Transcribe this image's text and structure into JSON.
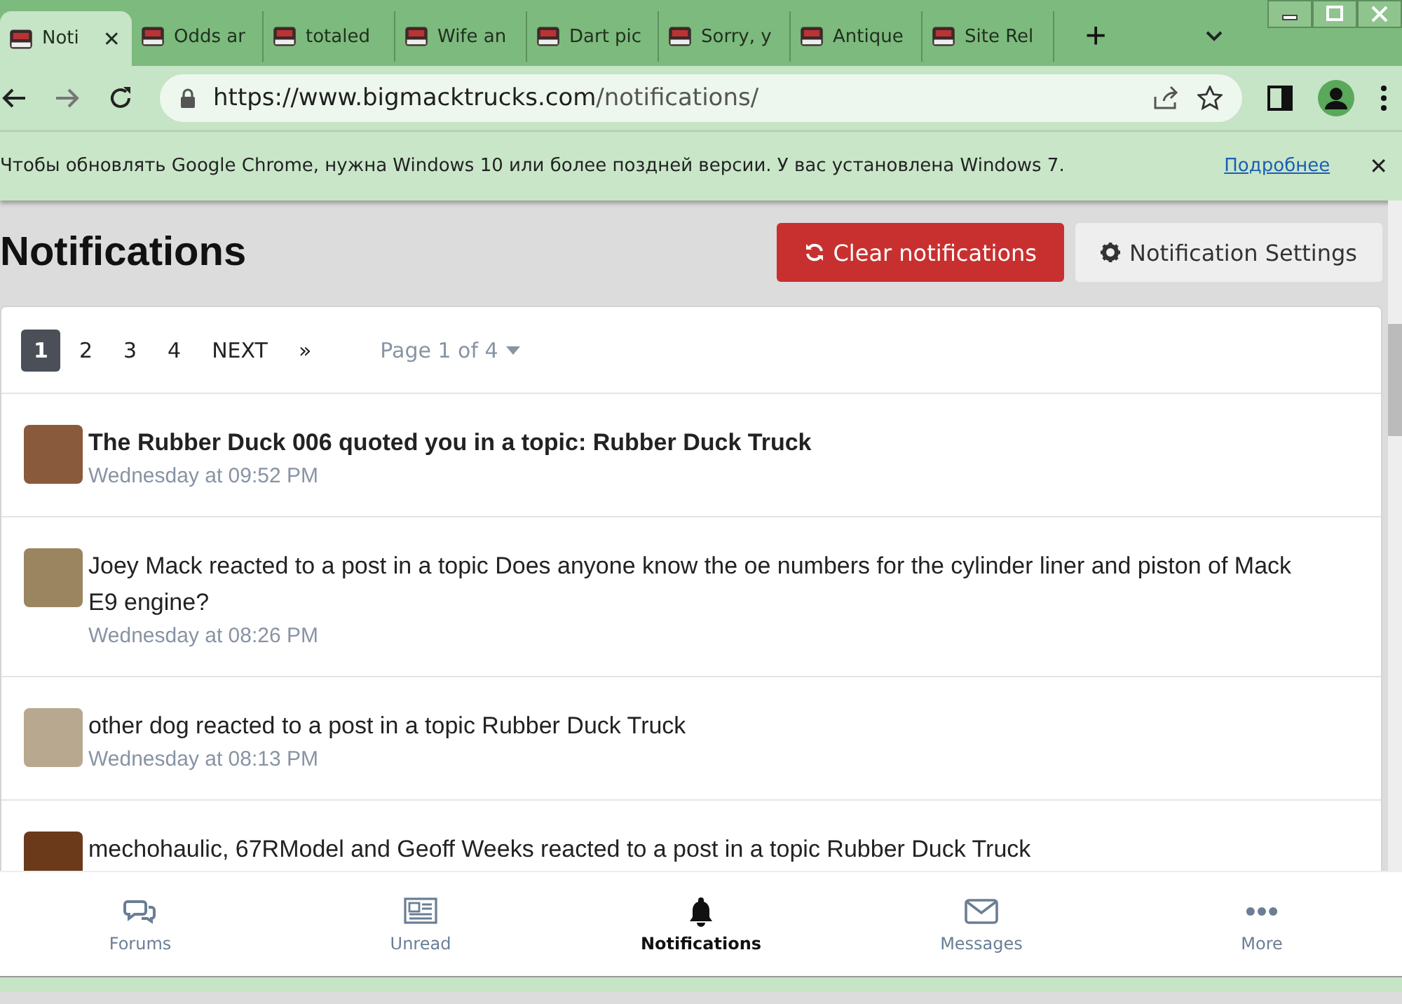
{
  "browser": {
    "tabs": [
      {
        "title": "Noti",
        "selected": true,
        "close": "✕"
      },
      {
        "title": "Odds ar",
        "selected": false
      },
      {
        "title": "totaled",
        "selected": false
      },
      {
        "title": "Wife an",
        "selected": false
      },
      {
        "title": "Dart pic",
        "selected": false
      },
      {
        "title": "Sorry, y",
        "selected": false
      },
      {
        "title": "Antique",
        "selected": false
      },
      {
        "title": "Site Rel",
        "selected": false
      }
    ],
    "new_tab": "+",
    "url_host": "https://www.bigmacktrucks.com",
    "url_path": "/notifications/",
    "infobar": {
      "message": "Чтобы обновлять Google Chrome, нужна Windows 10 или более поздней версии. У вас установлена Windows 7.",
      "link": "Подробнее",
      "close": "✕"
    }
  },
  "page": {
    "title": "Notifications",
    "clear_button": "Clear notifications",
    "settings_button": "Notification Settings",
    "pagination": {
      "pages": [
        {
          "label": "1",
          "selected": true
        },
        {
          "label": "2",
          "selected": false
        },
        {
          "label": "3",
          "selected": false
        },
        {
          "label": "4",
          "selected": false
        }
      ],
      "next": "NEXT",
      "last": "»",
      "page_select": "Page 1 of 4"
    },
    "notifications": [
      {
        "text": "The Rubber Duck 006 quoted you in a topic: Rubber Duck Truck",
        "time": "Wednesday at 09:52 PM",
        "unread": true
      },
      {
        "text": "Joey Mack reacted to a post in a topic Does anyone know the oe numbers for the cylinder liner and piston of Mack E9 engine?",
        "time": "Wednesday at 08:26 PM",
        "unread": false
      },
      {
        "text": "other dog reacted to a post in a topic Rubber Duck Truck",
        "time": "Wednesday at 08:13 PM",
        "unread": false
      },
      {
        "text": "mechohaulic, 67RModel and Geoff Weeks reacted to a post in a topic Rubber Duck Truck",
        "unread": false
      }
    ]
  },
  "bottom_nav": [
    {
      "kind": "forums",
      "label": "Forums",
      "selected": false
    },
    {
      "kind": "unread",
      "label": "Unread",
      "selected": false
    },
    {
      "kind": "notifications",
      "label": "Notifications",
      "selected": true
    },
    {
      "kind": "messages",
      "label": "Messages",
      "selected": false
    },
    {
      "kind": "more",
      "label": "More",
      "selected": false
    }
  ]
}
